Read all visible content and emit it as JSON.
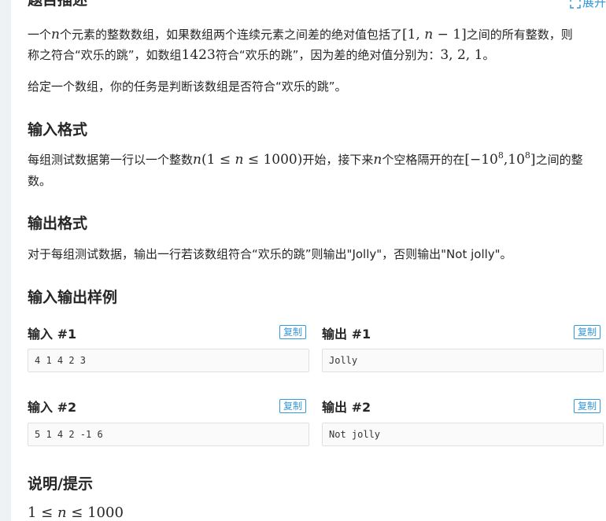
{
  "title_desc": "题目描述",
  "expand_label": "展开",
  "desc_p1": {
    "part1": "一个",
    "n": "n",
    "part2": "个元素的整数数组，如果数组两个连续元素之间差的绝对值包括了",
    "range_open": "[1, ",
    "range_n": "n",
    "range_close": " − 1]",
    "part3": "之间的所有整数，则",
    "line2_part1": "称之符合“欢乐的跳”，如数组",
    "example_num": "1423",
    "line2_part2": "符合“欢乐的跳”，因为差的绝对值分别为：",
    "diffs": "3, 2, 1",
    "line2_end": "。"
  },
  "desc_p2": "给定一个数组，你的任务是判断该数组是否符合“欢乐的跳”。",
  "title_input": "输入格式",
  "input_p": {
    "part1": "每组测试数据第一行以一个整数",
    "n": "n",
    "cond_open": "(1 ≤ ",
    "cond_n": "n",
    "cond_close": " ≤ 1000)",
    "part2": "开始，接下来",
    "n2": "n",
    "part3": "个空格隔开的在",
    "range_start": "[−10",
    "exp1": "8",
    "range_mid": ",10",
    "exp2": "8",
    "range_end": "]",
    "part4": "之间的整",
    "line2": "数。"
  },
  "title_output": "输出格式",
  "output_p": "对于每组测试数据，输出一行若该数组符合“欢乐的跳”则输出\"Jolly\"，否则输出\"Not jolly\"。",
  "title_samples": "输入输出样例",
  "samples": [
    {
      "in_label": "输入 #1",
      "out_label": "输出 #1",
      "input": "4 1 4 2 3",
      "output": "Jolly"
    },
    {
      "in_label": "输入 #2",
      "out_label": "输出 #2",
      "input": "5 1 4 2 -1 6",
      "output": "Not jolly"
    }
  ],
  "copy_label": "复制",
  "title_hint": "说明/提示",
  "hint": {
    "lhs": "1 ≤ ",
    "n": "n",
    "rhs": " ≤ 1000"
  },
  "colors": {
    "accent": "#3498db",
    "text": "#262626",
    "strip": "#eff2f5"
  }
}
